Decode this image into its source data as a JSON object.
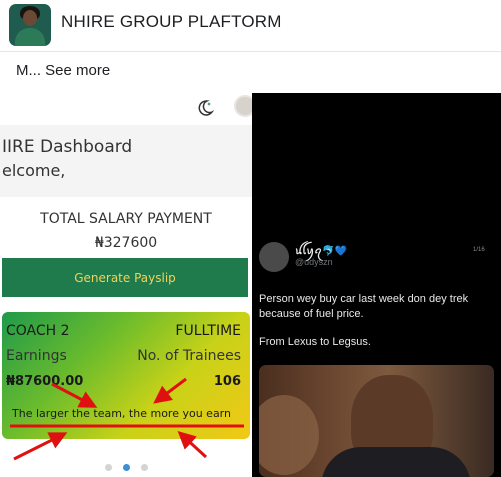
{
  "header": {
    "group_name": "NHIRE GROUP PLAFTORM",
    "avatar_icon": "group-avatar"
  },
  "post": {
    "text": "M...",
    "see_more": "See more"
  },
  "app_screenshot": {
    "dashboard_title": "IIRE Dashboard",
    "welcome": "elcome,",
    "salary_label": "TOTAL SALARY PAYMENT",
    "salary_value": "₦327600",
    "payslip_button": "Generate Payslip",
    "coach": {
      "name": "COACH 2",
      "type": "FULLTIME",
      "earnings_label": "Earnings",
      "trainees_label": "No. of Trainees",
      "earnings_value": "₦87600.00",
      "trainees_value": "106",
      "motto": "The larger the team, the more you earn"
    },
    "carousel": {
      "pages": 3,
      "active": 2
    },
    "accent_green": "#1f7a4c",
    "annotation_red": "#e01010"
  },
  "tweet_screenshot": {
    "display_name": "ꪊꪶꪗꪖ🐬💙",
    "handle": "@udyszn",
    "badge": "1/16",
    "text1": "Person wey buy car last week don dey trek because of fuel price.",
    "text2": "From Lexus to Legsus."
  }
}
